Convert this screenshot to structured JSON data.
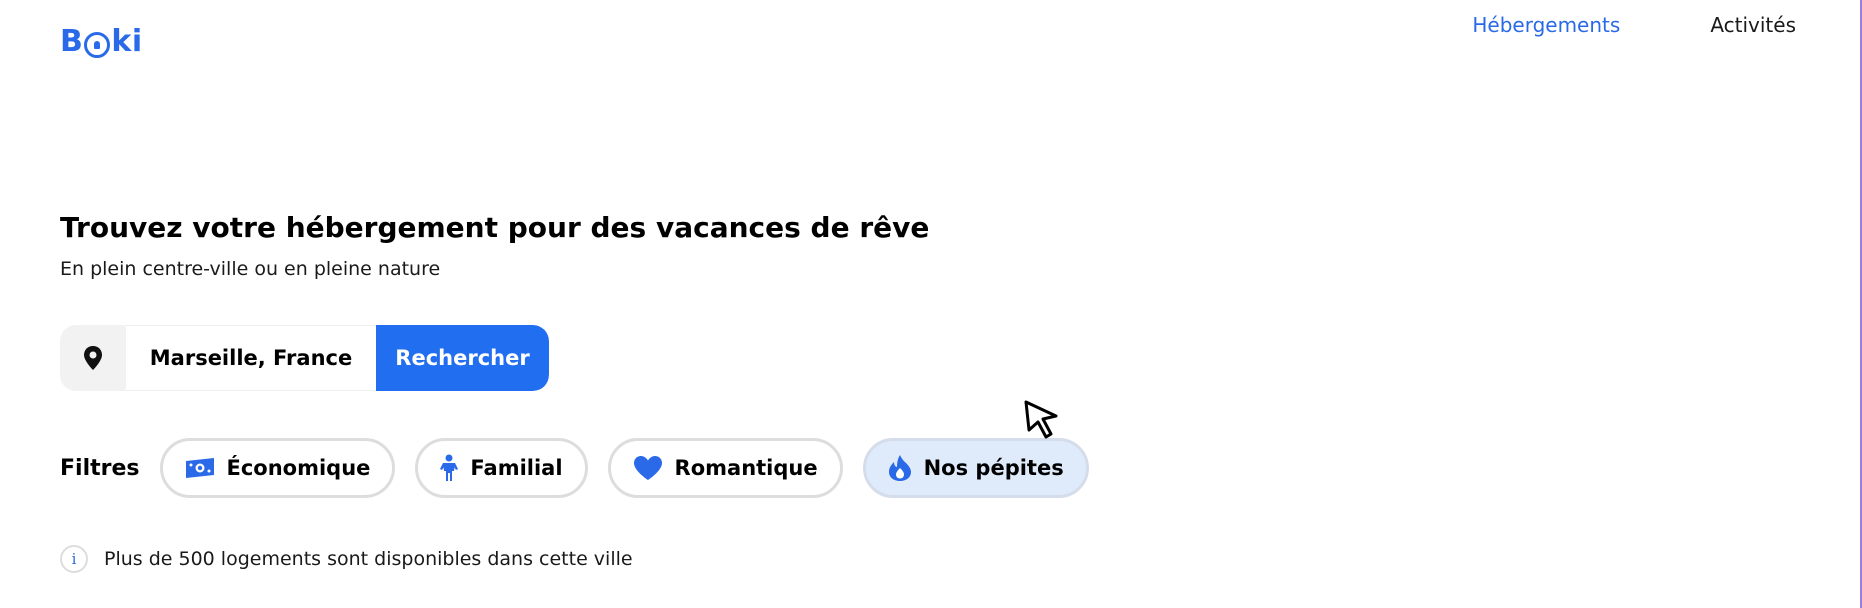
{
  "header": {
    "logo_text": "Booki",
    "nav": [
      {
        "label": "Hébergements",
        "active": true
      },
      {
        "label": "Activités",
        "active": false
      }
    ]
  },
  "hero": {
    "title": "Trouvez votre hébergement pour des vacances de rêve",
    "subtitle": "En plein centre-ville ou en pleine nature"
  },
  "search": {
    "icon": "location-pin-icon",
    "value": "Marseille, France",
    "button_label": "Rechercher"
  },
  "filters": {
    "label": "Filtres",
    "items": [
      {
        "label": "Économique",
        "icon": "money-icon",
        "selected": false
      },
      {
        "label": "Familial",
        "icon": "person-icon",
        "selected": false
      },
      {
        "label": "Romantique",
        "icon": "heart-icon",
        "selected": false
      },
      {
        "label": "Nos pépites",
        "icon": "fire-icon",
        "selected": true
      }
    ]
  },
  "info": {
    "icon": "info-icon",
    "glyph": "i",
    "text": "Plus de 500 logements sont disponibles dans cette ville"
  },
  "colors": {
    "accent": "#2a6ae8",
    "button": "#226ef0",
    "selected_chip_bg": "#dfeafb"
  }
}
